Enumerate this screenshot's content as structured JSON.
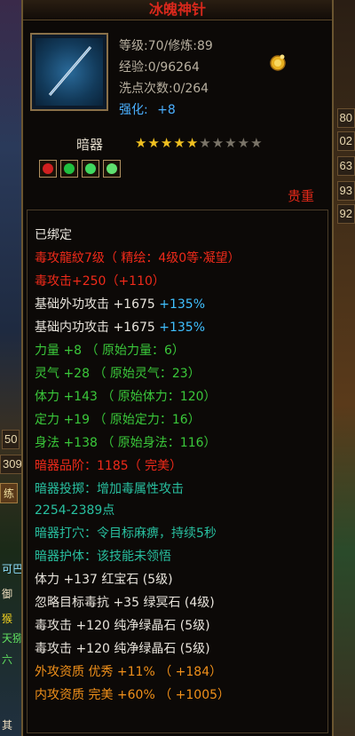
{
  "item": {
    "name": "冰魄神针",
    "level_line": "等级:70/修炼:89",
    "exp_line": "经验:0/96264",
    "reset_line": "洗点次数:0/264",
    "enhance_label": "强化:",
    "enhance_value": "+8",
    "type": "暗器",
    "stars_filled": 5,
    "stars_total": 10,
    "rarity": "贵重",
    "gems": [
      "red-gem",
      "green-gem",
      "green-gem",
      "green-gem"
    ]
  },
  "colors": {
    "title": "#d8281c",
    "white": "#e8e4dc",
    "red": "#f02a1a",
    "green": "#3ac83a",
    "teal": "#28c0a0",
    "blue": "#40c0ff",
    "orange": "#f0901a",
    "star": "#f0c020"
  },
  "attributes": [
    {
      "text": "已绑定",
      "color": "white"
    },
    {
      "text": "毒攻龍紋7级（ 精绘：4级0等·凝望）",
      "color": "red"
    },
    {
      "text": "毒攻击+250（+110）",
      "color": "red"
    },
    {
      "text": "基础外功攻击 +1675",
      "extra": " +135%",
      "color": "white"
    },
    {
      "text": "基础内功攻击 +1675",
      "extra": " +135%",
      "color": "white"
    },
    {
      "text": "力量 +8 （ 原始力量：6）",
      "color": "green"
    },
    {
      "text": "灵气 +28 （ 原始灵气：23）",
      "color": "green"
    },
    {
      "text": "体力 +143 （ 原始体力：120）",
      "color": "green"
    },
    {
      "text": "定力 +19 （ 原始定力：16）",
      "color": "green"
    },
    {
      "text": "身法 +138 （ 原始身法：116）",
      "color": "green"
    },
    {
      "text": "暗器品阶：1185（ 完美）",
      "color": "red"
    },
    {
      "text": "暗器投掷：增加毒属性攻击",
      "color": "teal"
    },
    {
      "text": "2254-2389点",
      "color": "teal"
    },
    {
      "text": "暗器打穴：令目标麻痹，持续5秒",
      "color": "teal"
    },
    {
      "text": "暗器护体：该技能未领悟",
      "color": "teal"
    },
    {
      "text": "体力 +137 红宝石 (5级)",
      "color": "white"
    },
    {
      "text": "忽略目标毒抗 +35 绿冥石 (4级)",
      "color": "white"
    },
    {
      "text": "毒攻击 +120 纯净绿晶石 (5级)",
      "color": "white"
    },
    {
      "text": "毒攻击 +120 纯净绿晶石 (5级)",
      "color": "white"
    },
    {
      "text": "外攻资质  优秀 +11% （ +184）",
      "color": "orange"
    },
    {
      "text": "内攻资质  完美 +60% （ +1005）",
      "color": "orange"
    }
  ],
  "side": {
    "right_numbers": [
      "80",
      "02",
      "63",
      "93",
      "92"
    ],
    "left_numbers": [
      "50",
      "309"
    ],
    "left_tab": "练",
    "left_texts": [
      "可巴",
      "御",
      "猴",
      "天猕",
      "六",
      "其"
    ]
  }
}
